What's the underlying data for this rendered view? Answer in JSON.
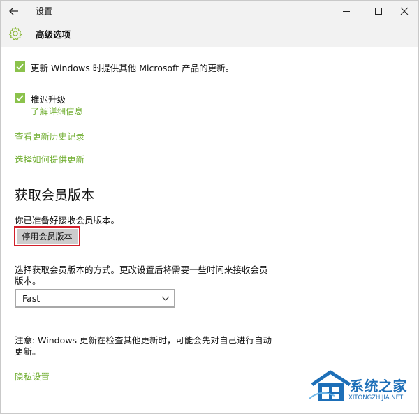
{
  "window": {
    "title": "设置"
  },
  "header": {
    "page_title": "高级选项"
  },
  "options": {
    "ms_updates_label": "更新 Windows 时提供其他 Microsoft 产品的更新。",
    "ms_updates_checked": true,
    "defer_label": "推迟升级",
    "defer_checked": true,
    "learn_more": "了解详细信息"
  },
  "links": {
    "history": "查看更新历史记录",
    "delivery": "选择如何提供更新"
  },
  "insider": {
    "section_title": "获取会员版本",
    "ready_text": "你已准备好接收会员版本。",
    "stop_button": "停用会员版本",
    "pace_description_line1": "选择获取会员版本的方式。更改设置后将需要一些时间来接收会员",
    "pace_description_line2": "版本。",
    "pace_selected": "Fast"
  },
  "note": {
    "line1": "注意: Windows 更新在检查其他更新时，可能会先对自己进行自动",
    "line2": "更新。"
  },
  "privacy_link": "隐私设置",
  "watermark": {
    "name": "系统之家",
    "url": "XITONGZHIJIA.NET"
  },
  "colors": {
    "accent": "#74b036",
    "checkbox": "#8bc24c",
    "highlight_border": "#d11f2a",
    "watermark": "#1d6fb8"
  }
}
